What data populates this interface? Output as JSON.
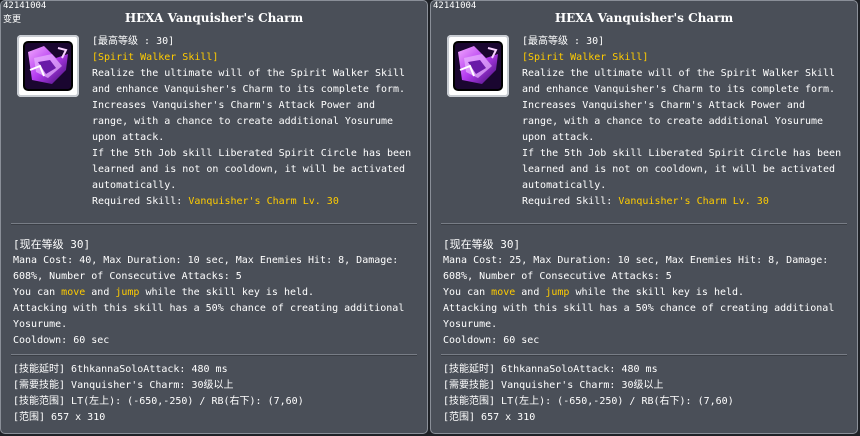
{
  "panels": [
    {
      "skill_id": "42141004",
      "changed_label": "变更",
      "title": "HEXA Vanquisher's Charm",
      "max_level": "[最高等级 : 30]",
      "skill_category": "[Spirit Walker Skill]",
      "description": [
        "Realize the ultimate will of the Spirit Walker Skill",
        "and enhance Vanquisher's Charm to its complete form.",
        "Increases Vanquisher's Charm's Attack Power and",
        "range, with a chance to create additional Yosurume",
        "upon attack.",
        "If the 5th Job skill Liberated Spirit Circle has been",
        "learned and is not on cooldown, it will be activated",
        "automatically."
      ],
      "required_label": "Required Skill: ",
      "required_value": "Vanquisher's Charm Lv. 30",
      "current_level": "[现在等级 30]",
      "stats_line1": "Mana Cost: 40, Max Duration: 10 sec, Max Enemies Hit: 8, Damage:",
      "stats_line2": "608%, Number of Consecutive Attacks: 5",
      "move_pre": "You can ",
      "move_word": "move",
      "move_mid": " and ",
      "jump_word": "jump",
      "move_post": " while the skill key is held.",
      "attack_line1": "Attacking with this skill has a 50% chance of creating additional",
      "attack_line2": "Yosurume.",
      "cooldown": "Cooldown: 60 sec",
      "extra": [
        "[技能延时] 6thkannaSoloAttack: 480 ms",
        "[需要技能] Vanquisher's Charm: 30级以上",
        "[技能范围] LT(左上): (-650,-250) / RB(右下): (7,60)",
        "[范围] 657 x 310"
      ]
    },
    {
      "skill_id": "42141004",
      "title": "HEXA Vanquisher's Charm",
      "max_level": "[最高等级 : 30]",
      "skill_category": "[Spirit Walker Skill]",
      "description": [
        "Realize the ultimate will of the Spirit Walker Skill",
        "and enhance Vanquisher's Charm to its complete form.",
        "Increases Vanquisher's Charm's Attack Power and",
        "range, with a chance to create additional Yosurume",
        "upon attack.",
        "If the 5th Job skill Liberated Spirit Circle has been",
        "learned and is not on cooldown, it will be activated",
        "automatically."
      ],
      "required_label": "Required Skill: ",
      "required_value": "Vanquisher's Charm Lv. 30",
      "current_level": "[现在等级 30]",
      "stats_line1": "Mana Cost: 25, Max Duration: 10 sec, Max Enemies Hit: 8, Damage:",
      "stats_line2": "608%, Number of Consecutive Attacks: 5",
      "move_pre": "You can ",
      "move_word": "move",
      "move_mid": " and ",
      "jump_word": "jump",
      "move_post": " while the skill key is held.",
      "attack_line1": "Attacking with this skill has a 50% chance of creating additional",
      "attack_line2": "Yosurume.",
      "cooldown": "Cooldown: 60 sec",
      "extra": [
        "[技能延时] 6thkannaSoloAttack: 480 ms",
        "[需要技能] Vanquisher's Charm: 30级以上",
        "[技能范围] LT(左上): (-650,-250) / RB(右下): (7,60)",
        "[范围] 657 x 310"
      ]
    }
  ],
  "colors": {
    "panel_bg": "#4a4f58",
    "highlight_yellow": "#ffcc00",
    "highlight_orange": "#ff9933",
    "text": "#ffffff"
  },
  "icon": "vanquishers-charm-skill-icon"
}
